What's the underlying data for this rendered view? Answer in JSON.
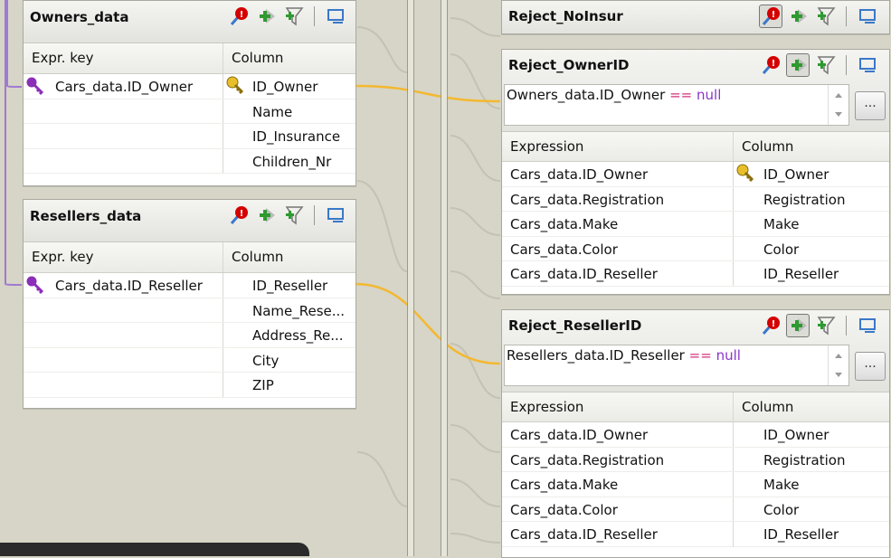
{
  "colors": {
    "link_orange": "#f4b830",
    "link_purple": "#a07ad0",
    "null_keyword": "#8a35c9",
    "operator": "#d3347a"
  },
  "owners_panel": {
    "title": "Owners_data",
    "col_expr": "Expr. key",
    "col_column": "Column",
    "rows": [
      {
        "expr": "Cars_data.ID_Owner",
        "column": "ID_Owner"
      },
      {
        "expr": "",
        "column": "Name"
      },
      {
        "expr": "",
        "column": "ID_Insurance"
      },
      {
        "expr": "",
        "column": "Children_Nr"
      }
    ]
  },
  "resellers_panel": {
    "title": "Resellers_data",
    "col_expr": "Expr. key",
    "col_column": "Column",
    "rows": [
      {
        "expr": "Cars_data.ID_Reseller",
        "column": "ID_Reseller"
      },
      {
        "expr": "",
        "column": "Name_Rese..."
      },
      {
        "expr": "",
        "column": "Address_Re..."
      },
      {
        "expr": "",
        "column": "City"
      },
      {
        "expr": "",
        "column": "ZIP"
      }
    ]
  },
  "reject_noinsur": {
    "title": "Reject_NoInsur"
  },
  "reject_ownerid": {
    "title": "Reject_OwnerID",
    "filter": {
      "lhs": "Owners_data.ID_Owner",
      "op": "==",
      "rhs": "null",
      "button": "..."
    },
    "col_expr": "Expression",
    "col_column": "Column",
    "rows": [
      {
        "expr": "Cars_data.ID_Owner",
        "column": "ID_Owner"
      },
      {
        "expr": "Cars_data.Registration",
        "column": "Registration"
      },
      {
        "expr": "Cars_data.Make",
        "column": "Make"
      },
      {
        "expr": "Cars_data.Color",
        "column": "Color"
      },
      {
        "expr": "Cars_data.ID_Reseller",
        "column": "ID_Reseller"
      }
    ]
  },
  "reject_resellerid": {
    "title": "Reject_ResellerID",
    "filter": {
      "lhs": "Resellers_data.ID_Reseller",
      "op": "==",
      "rhs": "null",
      "button": "..."
    },
    "col_expr": "Expression",
    "col_column": "Column",
    "rows": [
      {
        "expr": "Cars_data.ID_Owner",
        "column": "ID_Owner"
      },
      {
        "expr": "Cars_data.Registration",
        "column": "Registration"
      },
      {
        "expr": "Cars_data.Make",
        "column": "Make"
      },
      {
        "expr": "Cars_data.Color",
        "column": "Color"
      },
      {
        "expr": "Cars_data.ID_Reseller",
        "column": "ID_Reseller"
      }
    ]
  },
  "icons": [
    "warning-badge-icon",
    "add-row-icon",
    "add-filter-icon",
    "minimize-icon",
    "key-icon",
    "lookup-key-icon"
  ]
}
